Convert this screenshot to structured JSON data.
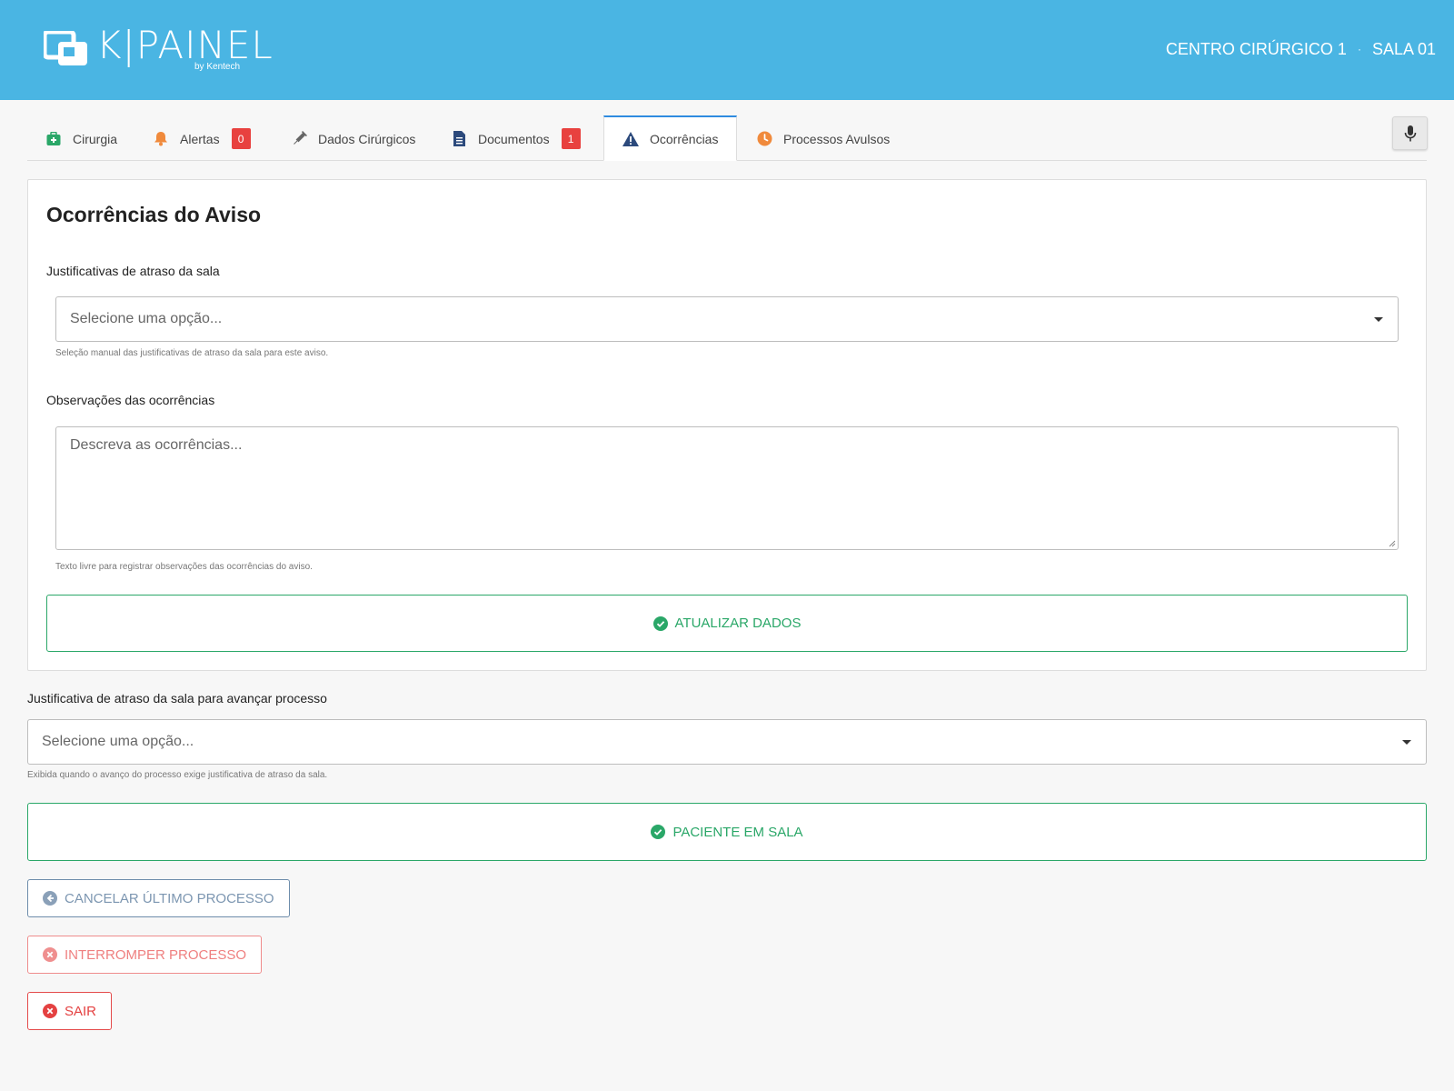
{
  "header": {
    "logo_text": "K|PAINEL",
    "logo_sub": "by Kentech",
    "center": "CENTRO CIRÚRGICO 1",
    "separator": "·",
    "room": "SALA 01"
  },
  "tabs": [
    {
      "label": "Cirurgia",
      "icon": "medical-kit-icon"
    },
    {
      "label": "Alertas",
      "icon": "bell-icon",
      "badge": "0"
    },
    {
      "label": "Dados Cirúrgicos",
      "icon": "syringe-icon"
    },
    {
      "label": "Documentos",
      "icon": "document-icon",
      "badge": "1"
    },
    {
      "label": "Ocorrências",
      "icon": "warning-icon",
      "active": true
    },
    {
      "label": "Processos Avulsos",
      "icon": "clock-icon"
    }
  ],
  "card": {
    "title": "Ocorrências do Aviso",
    "delay_label": "Justificativas de atraso da sala",
    "delay_placeholder": "Selecione uma opção...",
    "delay_help": "Seleção manual das justificativas de atraso da sala para este aviso.",
    "notes_label": "Observações das ocorrências",
    "notes_placeholder": "Descreva as ocorrências...",
    "notes_help": "Texto livre para registrar observações das ocorrências do aviso.",
    "update_button": "ATUALIZAR DADOS"
  },
  "advance": {
    "label": "Justificativa de atraso da sala para avançar processo",
    "placeholder": "Selecione uma opção...",
    "help": "Exibida quando o avanço do processo exige justificativa de atraso da sala.",
    "patient_button": "PACIENTE EM SALA"
  },
  "actions": {
    "cancel": "CANCELAR ÚLTIMO PROCESSO",
    "interrupt": "INTERROMPER PROCESSO",
    "exit": "SAIR"
  },
  "colors": {
    "header": "#4ab5e3",
    "active_tab": "#2f8be0",
    "badge": "#e8413f",
    "success": "#2aa768",
    "cancel": "#7c96b1",
    "interrupt": "#ef7f7f",
    "exit": "#e44141"
  }
}
